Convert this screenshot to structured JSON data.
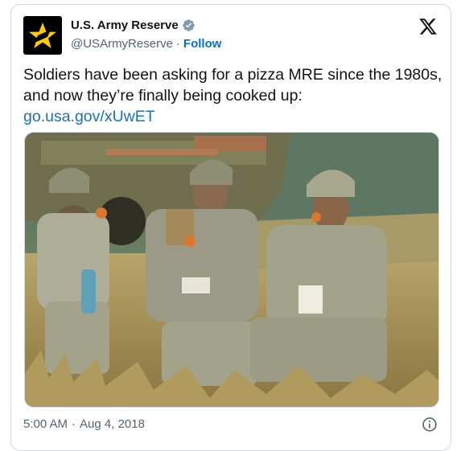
{
  "account": {
    "name": "U.S. Army Reserve",
    "handle": "@USArmyReserve",
    "separator": "·",
    "follow_label": "Follow"
  },
  "tweet": {
    "text": "Soldiers have been asking for a pizza MRE since the 1980s, and now they’re finally being cooked up:",
    "link": "go.usa.gov/xUwET"
  },
  "meta": {
    "time": "5:00 AM",
    "separator": "·",
    "date": "Aug 4, 2018"
  },
  "icons": {
    "avatar": "army-star-logo",
    "verified": "verified-badge-icon",
    "platform": "x-logo-icon",
    "info": "info-icon"
  },
  "colors": {
    "link": "#1d70b8",
    "follow": "#006fd6",
    "verified": "#829aab",
    "avatar_bg": "#000000",
    "star": "#ffcc00"
  }
}
